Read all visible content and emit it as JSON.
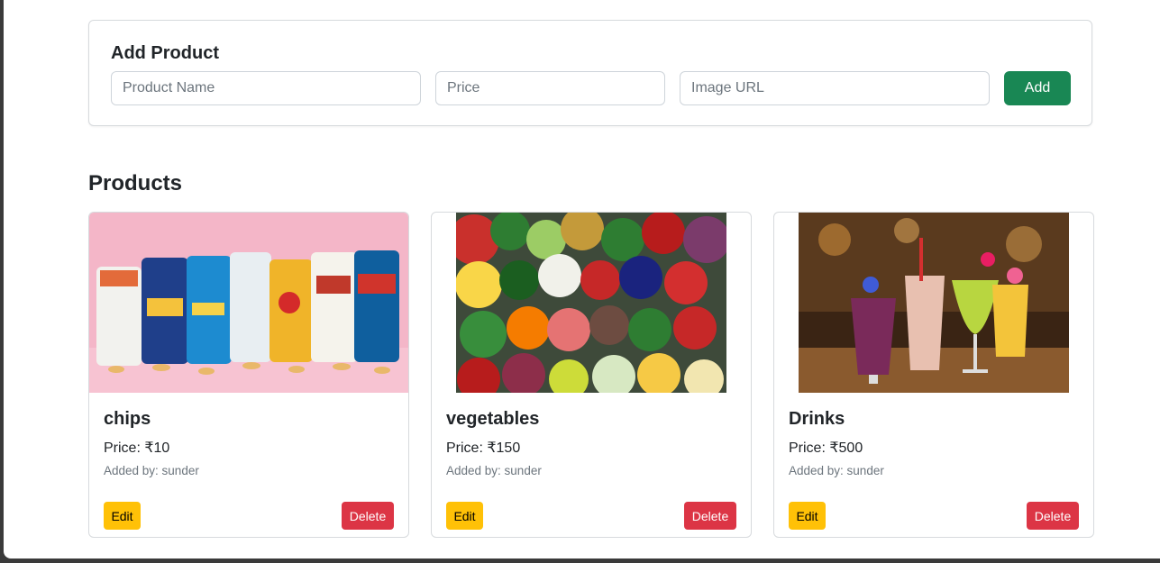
{
  "add_form": {
    "title": "Add Product",
    "name_placeholder": "Product Name",
    "price_placeholder": "Price",
    "url_placeholder": "Image URL",
    "add_label": "Add"
  },
  "products_section": {
    "title": "Products",
    "items": [
      {
        "name": "chips",
        "price": "Price: ₹10",
        "added_by": "Added by: sunder",
        "edit_label": "Edit",
        "delete_label": "Delete",
        "image": "chips-photo"
      },
      {
        "name": "vegetables",
        "price": "Price: ₹150",
        "added_by": "Added by: sunder",
        "edit_label": "Edit",
        "delete_label": "Delete",
        "image": "vegetables-photo"
      },
      {
        "name": "Drinks",
        "price": "Price: ₹500",
        "added_by": "Added by: sunder",
        "edit_label": "Edit",
        "delete_label": "Delete",
        "image": "drinks-photo"
      }
    ]
  },
  "colors": {
    "add_button": "#198754",
    "edit_button": "#ffc107",
    "delete_button": "#dc3545"
  }
}
